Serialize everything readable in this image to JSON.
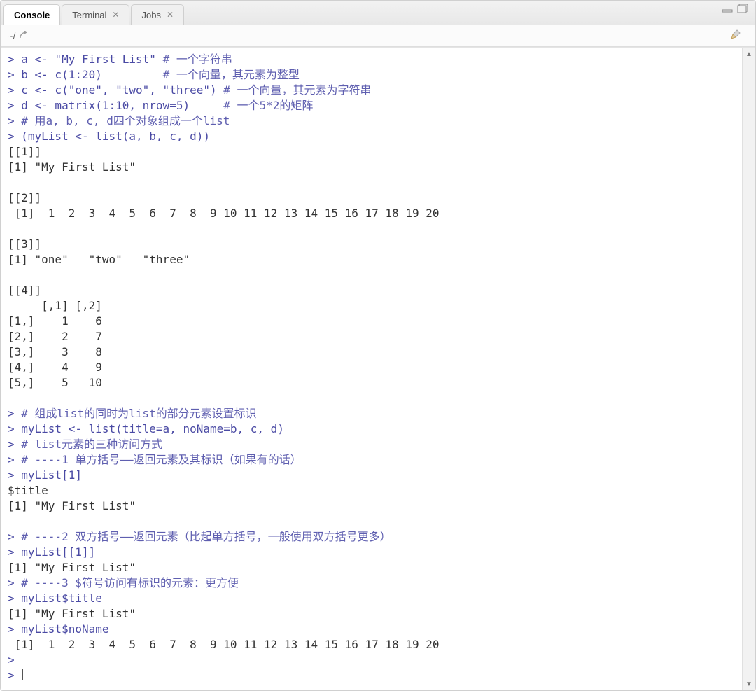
{
  "tabs": {
    "console": "Console",
    "terminal": "Terminal",
    "jobs": "Jobs"
  },
  "toolbar": {
    "wd": "~/"
  },
  "console_lines": [
    {
      "t": "in",
      "code": "a <- \"My First List\" ",
      "comment": "# 一个字符串"
    },
    {
      "t": "in",
      "code": "b <- c(1:20)         ",
      "comment": "# 一个向量，其元素为整型"
    },
    {
      "t": "in",
      "code": "c <- c(\"one\", \"two\", \"three\") ",
      "comment": "# 一个向量，其元素为字符串"
    },
    {
      "t": "in",
      "code": "d <- matrix(1:10, nrow=5)     ",
      "comment": "# 一个5*2的矩阵"
    },
    {
      "t": "in",
      "code": "",
      "comment": "# 用a, b, c, d四个对象组成一个list"
    },
    {
      "t": "in",
      "code": "(myList <- list(a, b, c, d))",
      "comment": ""
    },
    {
      "t": "out",
      "text": "[[1]]"
    },
    {
      "t": "out",
      "text": "[1] \"My First List\""
    },
    {
      "t": "blank"
    },
    {
      "t": "out",
      "text": "[[2]]"
    },
    {
      "t": "out",
      "text": " [1]  1  2  3  4  5  6  7  8  9 10 11 12 13 14 15 16 17 18 19 20"
    },
    {
      "t": "blank"
    },
    {
      "t": "out",
      "text": "[[3]]"
    },
    {
      "t": "out",
      "text": "[1] \"one\"   \"two\"   \"three\""
    },
    {
      "t": "blank"
    },
    {
      "t": "out",
      "text": "[[4]]"
    },
    {
      "t": "out",
      "text": "     [,1] [,2]"
    },
    {
      "t": "out",
      "text": "[1,]    1    6"
    },
    {
      "t": "out",
      "text": "[2,]    2    7"
    },
    {
      "t": "out",
      "text": "[3,]    3    8"
    },
    {
      "t": "out",
      "text": "[4,]    4    9"
    },
    {
      "t": "out",
      "text": "[5,]    5   10"
    },
    {
      "t": "blank"
    },
    {
      "t": "in",
      "code": "",
      "comment": "# 组成list的同时为list的部分元素设置标识"
    },
    {
      "t": "in",
      "code": "myList <- list(title=a, noName=b, c, d)",
      "comment": ""
    },
    {
      "t": "in",
      "code": "",
      "comment": "# list元素的三种访问方式"
    },
    {
      "t": "in",
      "code": "",
      "comment": "# ----1 单方括号——返回元素及其标识（如果有的话）"
    },
    {
      "t": "in",
      "code": "myList[1]",
      "comment": ""
    },
    {
      "t": "out",
      "text": "$title"
    },
    {
      "t": "out",
      "text": "[1] \"My First List\""
    },
    {
      "t": "blank"
    },
    {
      "t": "in",
      "code": "",
      "comment": "# ----2 双方括号——返回元素（比起单方括号，一般使用双方括号更多）"
    },
    {
      "t": "in",
      "code": "myList[[1]]",
      "comment": ""
    },
    {
      "t": "out",
      "text": "[1] \"My First List\""
    },
    {
      "t": "in",
      "code": "",
      "comment": "# ----3 $符号访问有标识的元素：更方便"
    },
    {
      "t": "in",
      "code": "myList$title",
      "comment": ""
    },
    {
      "t": "out",
      "text": "[1] \"My First List\""
    },
    {
      "t": "in",
      "code": "myList$noName",
      "comment": ""
    },
    {
      "t": "out",
      "text": " [1]  1  2  3  4  5  6  7  8  9 10 11 12 13 14 15 16 17 18 19 20"
    },
    {
      "t": "in",
      "code": "",
      "comment": ""
    },
    {
      "t": "in-cursor",
      "code": "",
      "comment": ""
    }
  ]
}
